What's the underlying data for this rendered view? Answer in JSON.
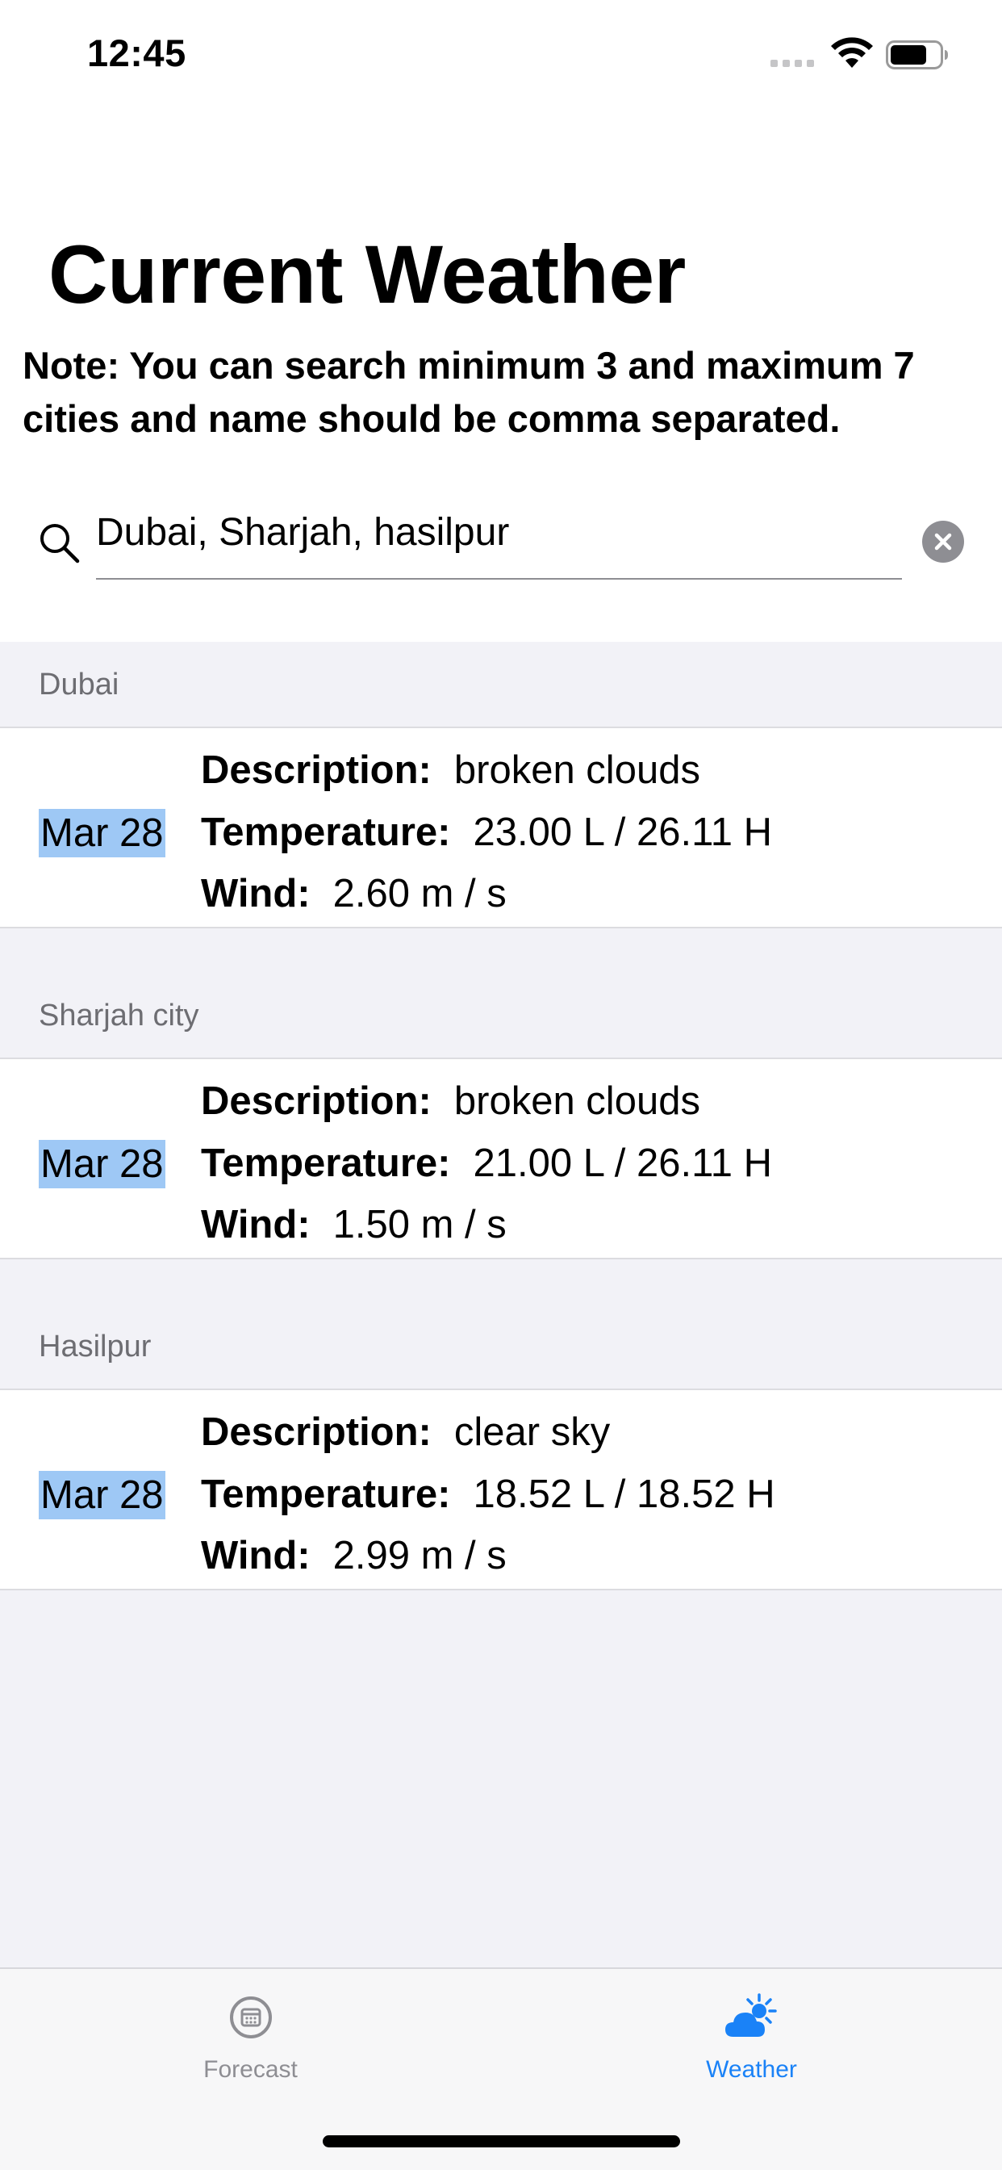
{
  "status_bar": {
    "time": "12:45"
  },
  "page_title": "Current Weather",
  "note": "Note: You can search minimum 3 and maximum 7 cities and name should be comma separated.",
  "search": {
    "value": "Dubai, Sharjah, hasilpur",
    "icon": "search-icon",
    "clear_icon": "close-icon"
  },
  "sections": [
    {
      "header": "Dubai",
      "row": {
        "date": "Mar 28",
        "description_label": "Description:",
        "description": "broken clouds",
        "temperature_label": "Temperature:",
        "temperature": "23.00 L / 26.11 H",
        "wind_label": "Wind:",
        "wind": "2.60 m / s"
      }
    },
    {
      "header": "Sharjah city",
      "row": {
        "date": "Mar 28",
        "description_label": "Description:",
        "description": "broken clouds",
        "temperature_label": "Temperature:",
        "temperature": "21.00 L / 26.11 H",
        "wind_label": "Wind:",
        "wind": "1.50 m / s"
      }
    },
    {
      "header": "Hasilpur",
      "row": {
        "date": "Mar 28",
        "description_label": "Description:",
        "description": "clear sky",
        "temperature_label": "Temperature:",
        "temperature": "18.52 L / 18.52 H",
        "wind_label": "Wind:",
        "wind": "2.99 m / s"
      }
    }
  ],
  "tabs": [
    {
      "label": "Forecast",
      "icon": "calendar-icon",
      "selected": false
    },
    {
      "label": "Weather",
      "icon": "cloud-sun-icon",
      "selected": true
    }
  ],
  "colors": {
    "accent": "#1a82f7",
    "date_highlight": "#9ec8f5",
    "list_background": "#f2f2f7"
  }
}
